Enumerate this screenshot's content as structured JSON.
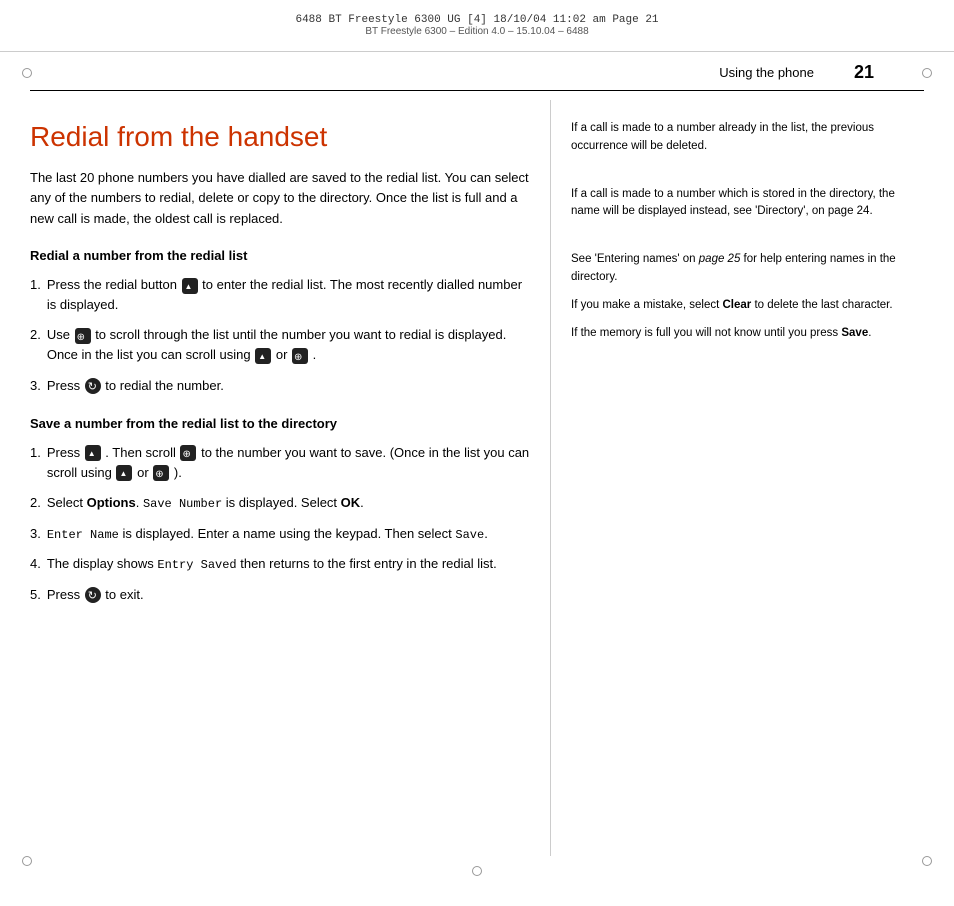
{
  "header": {
    "line1": "6488 BT Freestyle 6300 UG [4]   18/10/04  11:02 am  Page 21",
    "line2": "BT Freestyle 6300 – Edition 4.0 – 15.10.04 – 6488"
  },
  "page": {
    "title": "Using the phone",
    "number": "21"
  },
  "section": {
    "title": "Redial from the handset",
    "intro": "The last 20 phone numbers you have dialled are saved to the redial list. You can select any of the numbers to redial, delete or copy to the directory. Once the list is full and a new call is made, the oldest call is replaced.",
    "subsection1": {
      "heading": "Redial a number from the redial list",
      "steps": [
        {
          "num": "1.",
          "text_before": "Press the redial button",
          "icon1": "redial-up-icon",
          "text_after": "to enter the redial list. The most recently dialled number is displayed."
        },
        {
          "num": "2.",
          "text_before": "Use",
          "icon1": "scroll-icon",
          "text_middle": "to scroll through the list until the number you want to redial is displayed. Once in the list you can scroll using",
          "icon2": "redial-up2-icon",
          "text_or": "or",
          "icon3": "scroll2-icon",
          "text_end": "."
        },
        {
          "num": "3.",
          "text_before": "Press",
          "icon1": "redial-icon",
          "text_after": "to redial the number."
        }
      ]
    },
    "subsection2": {
      "heading": "Save a number from the redial list to the directory",
      "steps": [
        {
          "num": "1.",
          "text_before": "Press",
          "icon1": "save-icon",
          "text_middle": ". Then scroll",
          "icon2": "scroll3-icon",
          "text_after": "to the number you want to save. (Once in the list you can scroll using",
          "icon3": "up3-icon",
          "text_or": "or",
          "icon4": "down3-icon",
          "text_end": ")."
        },
        {
          "num": "2.",
          "text_before": "Select",
          "bold1": "Options",
          "text_middle": ".",
          "mono1": "Save Number",
          "text_after": "is displayed. Select",
          "bold2": "OK",
          "text_end": "."
        },
        {
          "num": "3.",
          "mono1": "Enter Name",
          "text_after": "is displayed. Enter a name using the keypad. Then select",
          "mono2": "Save",
          "text_end": "."
        },
        {
          "num": "4.",
          "text_before": "The display shows",
          "mono1": "Entry  Saved",
          "text_after": "then returns to the first entry in the redial list."
        },
        {
          "num": "5.",
          "text_before": "Press",
          "icon1": "exit-icon",
          "text_after": "to exit."
        }
      ]
    }
  },
  "sidebar": {
    "note1": "If a call is made to a number already in the list, the previous occurrence will be deleted.",
    "note2": "If a call is made to a number which is stored in the directory, the name will be displayed instead, see 'Directory', on page 24.",
    "note3_parts": [
      "See 'Entering names' on page 25 for help entering names in the directory.",
      "If you make a mistake, select Clear to delete the last character.",
      "If the memory is full you will not know until you press Save."
    ]
  }
}
